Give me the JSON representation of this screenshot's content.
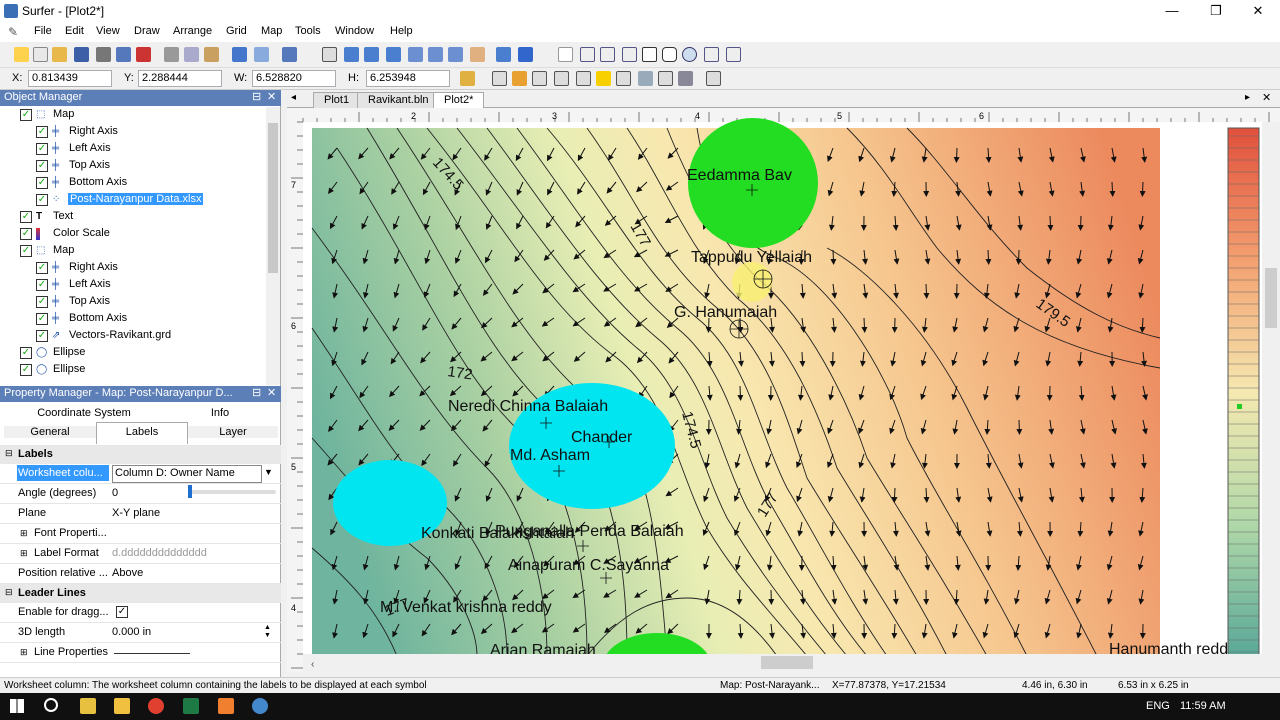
{
  "window": {
    "title": "Surfer - [Plot2*]",
    "minimize": "—",
    "restore": "❐",
    "close": "✕"
  },
  "menu": [
    "File",
    "Edit",
    "View",
    "Draw",
    "Arrange",
    "Grid",
    "Map",
    "Tools",
    "Window",
    "Help"
  ],
  "coords": {
    "x_label": "X:",
    "x_value": "0.813439",
    "y_label": "Y:",
    "y_value": "2.288444",
    "w_label": "W:",
    "w_value": "6.528820",
    "h_label": "H:",
    "h_value": "6.253948"
  },
  "object_manager": {
    "title": "Object Manager",
    "items": [
      {
        "label": "Map",
        "type": "map"
      },
      {
        "label": "Right Axis",
        "type": "axis"
      },
      {
        "label": "Left Axis",
        "type": "axis"
      },
      {
        "label": "Top Axis",
        "type": "axis"
      },
      {
        "label": "Bottom Axis",
        "type": "axis"
      },
      {
        "label": "Post-Narayanpur Data.xlsx",
        "type": "post"
      },
      {
        "label": "Text",
        "type": "text"
      },
      {
        "label": "Color Scale",
        "type": "scale"
      },
      {
        "label": "Map",
        "type": "map"
      },
      {
        "label": "Right Axis",
        "type": "axis"
      },
      {
        "label": "Left Axis",
        "type": "axis"
      },
      {
        "label": "Top Axis",
        "type": "axis"
      },
      {
        "label": "Bottom Axis",
        "type": "axis"
      },
      {
        "label": "Vectors-Ravikant.grd",
        "type": "vector"
      },
      {
        "label": "Ellipse",
        "type": "ellipse"
      },
      {
        "label": "Ellipse",
        "type": "ellipse"
      }
    ]
  },
  "property_manager": {
    "title": "Property Manager - Map: Post-Narayanpur D...",
    "tabs_row1": [
      "Coordinate System",
      "Info"
    ],
    "tabs_row2": [
      "General",
      "Labels",
      "Layer"
    ],
    "sections": {
      "labels": "Labels",
      "leader": "Leader Lines"
    },
    "props": {
      "worksheet_name": "Worksheet colu...",
      "worksheet_value": "Column D:  Owner Name",
      "angle_name": "Angle (degrees)",
      "angle_value": "0",
      "plane_name": "Plane",
      "plane_value": "X-Y plane",
      "font_name": "Font Properti...",
      "format_name": "Label Format",
      "format_value": "d.dddddddddddddd",
      "position_name": "Position relative ...",
      "position_value": "Above",
      "drag_name": "Enable for dragg...",
      "length_name": "3D length",
      "length_value": "0.000 in",
      "lineprops_name": "Line Properties"
    }
  },
  "doc_tabs": [
    "Plot1",
    "Ravikant.bln",
    "Plot2*"
  ],
  "ruler": {
    "top": [
      "2",
      "3",
      "4",
      "5",
      "6"
    ],
    "left": [
      "7",
      "6",
      "5",
      "4"
    ]
  },
  "map_labels": {
    "contours": [
      "174.5",
      "177",
      "172",
      "174.5",
      "177",
      "179.5",
      "177"
    ],
    "names": [
      "Eedamma Bav",
      "Tappudu Yellaiah",
      "G. Hanumaiah",
      "Neredi Chinna Balaiah",
      "Chander",
      "Md. Asham",
      "Konkati Balakishtaiah",
      "Punganalla Penda Balaiah",
      "Ainapuram C.Sayanna",
      "M. Venkat krishna reddy",
      "Arjan Ramaiah",
      "Hanumanth reddy"
    ]
  },
  "status": {
    "hint": "Worksheet column: The worksheet column containing the labels to be displayed at each symbol",
    "object": "Map: Post-Narayank...",
    "xy": "X=77.87378, Y=17.21534",
    "pos": "4.46 in, 6.30 in",
    "size": "6.53 in x 6.25 in"
  },
  "taskbar": {
    "lang": "ENG",
    "time": "11:59 AM"
  },
  "colors": {
    "panel_header": "#5d7fb8",
    "circle_green": "#22dd22",
    "circle_cyan": "#00e5f0"
  }
}
